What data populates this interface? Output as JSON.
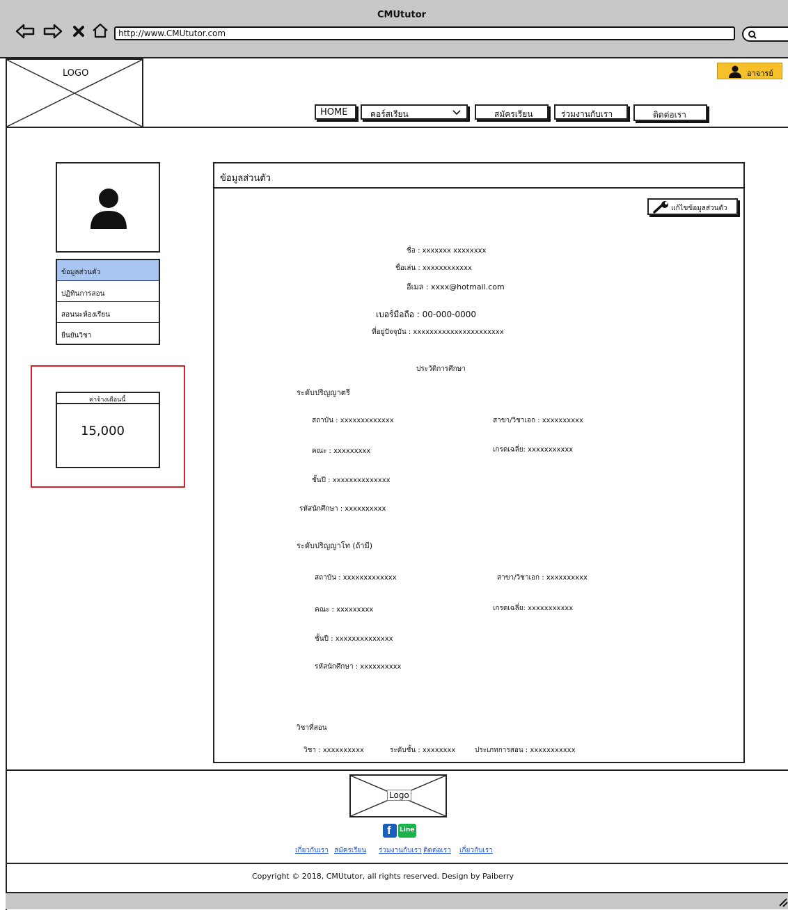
{
  "window": {
    "title": "CMUtutor",
    "url": "http://www.CMUtutor.com"
  },
  "header": {
    "logo_label": "LOGO",
    "user_button": "อาจารย์",
    "nav": {
      "home": "HOME",
      "courses": "คอร์สเรียน",
      "apply": "สมัครเรียน",
      "partner": "ร่วมงานกับเรา",
      "contact": "ติดต่อเรา"
    }
  },
  "sidebar": {
    "menu": [
      "ข้อมูลส่วนตัว",
      "ปฏิทินการสอน",
      "สอนนะห้องเรียน",
      "ยืนยันวิชา"
    ],
    "income_title": "ค่าจ้างเดือนนี้",
    "income_value": "15,000"
  },
  "profile": {
    "panel_title": "ข้อมูลส่วนตัว",
    "edit_button": "แก้ไขข้อมูลส่วนตัว",
    "name": "ชื่อ : xxxxxxx xxxxxxxx",
    "nickname": "ชื่อเล่น : xxxxxxxxxxxx",
    "email": "อีเมล : xxxx@hotmail.com",
    "phone": "เบอร์มือถือ : 00-000-0000",
    "address": "ที่อยู่ปัจจุบัน : xxxxxxxxxxxxxxxxxxxxxx",
    "education_heading": "ประวัติการศึกษา",
    "bachelor": {
      "heading": "ระดับปริญญาตรี",
      "institution": "สถาบัน : xxxxxxxxxxxxx",
      "major": "สาขา/วิชาเอก : xxxxxxxxxx",
      "faculty": "คณะ : xxxxxxxxx",
      "gpa": "เกรดเฉลี่ย: xxxxxxxxxxx",
      "year": "ชั้นปี : xxxxxxxxxxxxxx",
      "student_id": "รหัสนักศึกษา : xxxxxxxxxx"
    },
    "master": {
      "heading": "ระดับปริญญาโท (ถ้ามี)",
      "institution": "สถาบัน : xxxxxxxxxxxxx",
      "major": "สาขา/วิชาเอก : xxxxxxxxxx",
      "faculty": "คณะ : xxxxxxxxx",
      "gpa": "เกรดเฉลี่ย: xxxxxxxxxxx",
      "year": "ชั้นปี : xxxxxxxxxxxxxx",
      "student_id": "รหัสนักศึกษา : xxxxxxxxxx"
    },
    "teaching": {
      "heading": "วิชาที่สอน",
      "subject": "วิชา : xxxxxxxxxx",
      "level": "ระดับชั้น : xxxxxxxx",
      "type": "ประเภทการสอน : xxxxxxxxxxx"
    }
  },
  "footer": {
    "logo_label": "Logo",
    "line_label": "Line",
    "links": [
      "เกี่ยวกับเรา",
      "สมัครเรียน",
      "ร่วมงานกับเรา",
      "ติดต่อเรา",
      "เกี่ยวกับเรา"
    ],
    "copyright": "Copyright © 2018, CMUtutor, all rights reserved. Design by Paiberry"
  },
  "colors": {
    "accent_button": "#f5c02a",
    "active_menu": "#a9c6f2",
    "highlight_border": "#d42020",
    "facebook": "#1b5fb8",
    "line": "#19b34a"
  }
}
